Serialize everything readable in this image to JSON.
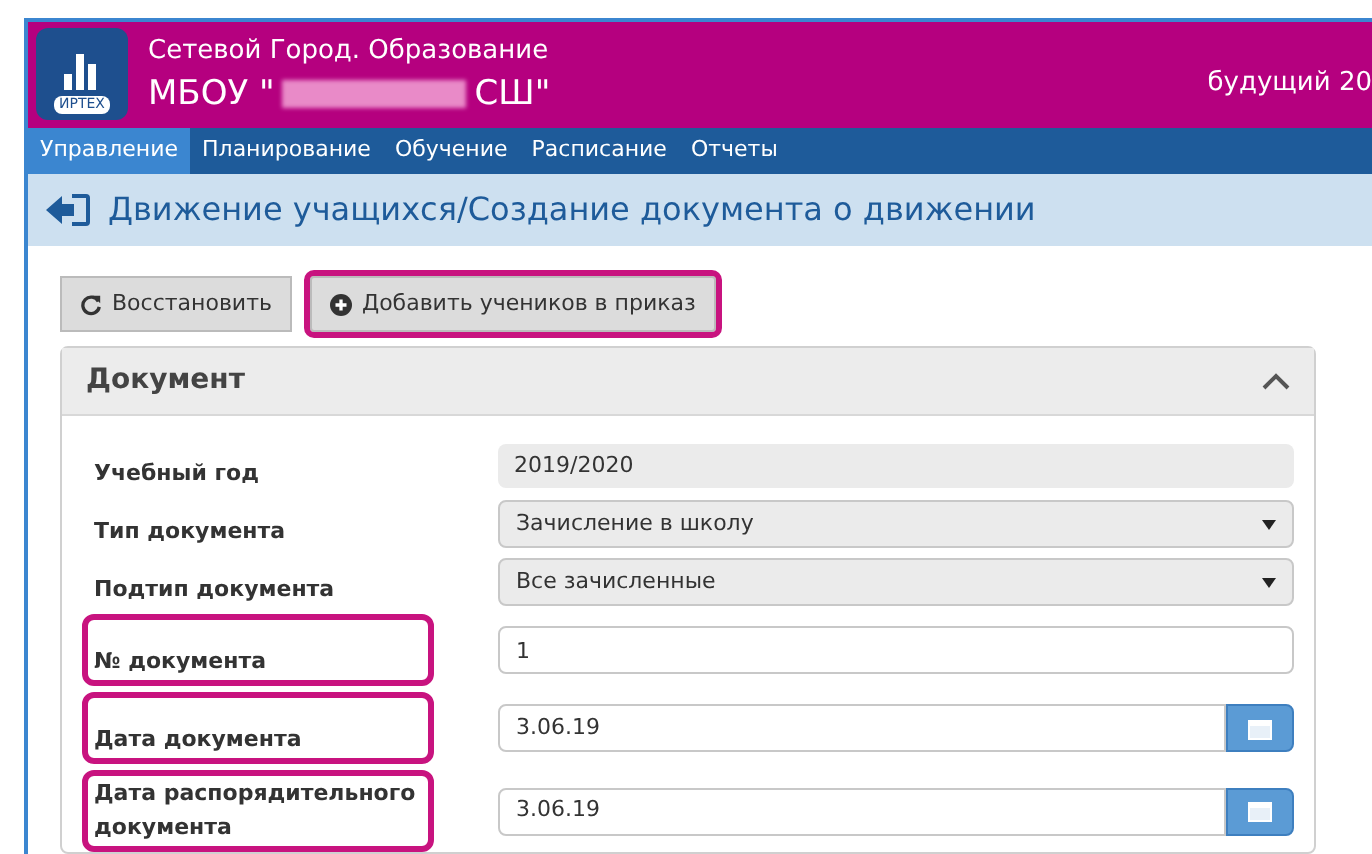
{
  "header": {
    "logo_text": "ИРТЕХ",
    "app_title": "Сетевой Город. Образование",
    "school_prefix": "МБОУ \"",
    "school_suffix": "СШ\"",
    "redacted": true,
    "right_text": "будущий 20"
  },
  "nav": [
    {
      "label": "Управление",
      "selected": true
    },
    {
      "label": "Планирование",
      "selected": false
    },
    {
      "label": "Обучение",
      "selected": false
    },
    {
      "label": "Расписание",
      "selected": false
    },
    {
      "label": "Отчеты",
      "selected": false
    }
  ],
  "page_title": "Движение учащихся/Создание документа о движении",
  "buttons": [
    {
      "label": "Восстановить",
      "kind": "restore",
      "highlighted": false
    },
    {
      "label": "Добавить учеников в приказ",
      "kind": "add",
      "highlighted": true
    }
  ],
  "panel": {
    "title": "Документ",
    "expanded": true,
    "fields": [
      {
        "label": "Учебный год",
        "kind": "readonly",
        "value": "2019/2020",
        "highlighted": false
      },
      {
        "label": "Тип документа",
        "kind": "select",
        "value": "Зачисление в школу",
        "highlighted": false
      },
      {
        "label": "Подтип документа",
        "kind": "select",
        "value": "Все зачисленные",
        "highlighted": false
      },
      {
        "label": "№ документа",
        "kind": "text",
        "value": "1",
        "highlighted": true
      },
      {
        "label": "Дата документа",
        "kind": "date",
        "value": "3.06.19",
        "highlighted": true
      },
      {
        "label": "Дата распорядительного документа",
        "kind": "date",
        "value": "3.06.19",
        "highlighted": true
      }
    ]
  }
}
